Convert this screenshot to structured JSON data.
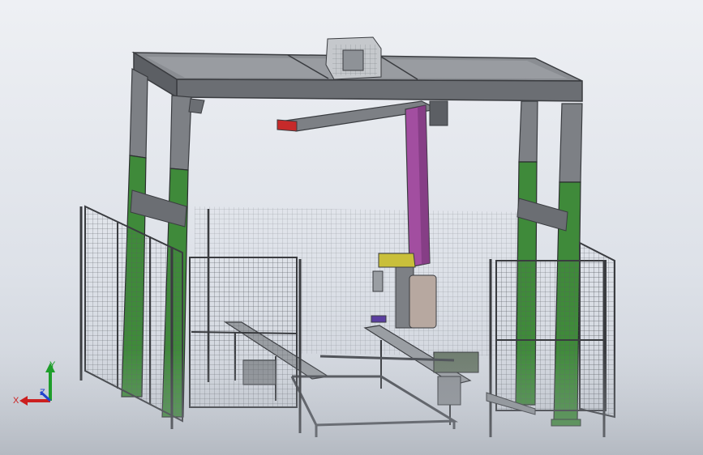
{
  "app": {
    "view": "cad-3d-assembly-viewport"
  },
  "triad": {
    "x_label": "X",
    "y_label": "Y",
    "z_label": "Z",
    "x_color": "#cc1f1f",
    "y_color": "#1e9e2a",
    "z_color": "#2244cc"
  },
  "model": {
    "frame_color": "#6f7278",
    "frame_dark": "#4d5056",
    "green_color": "#3f8a3a",
    "magenta_color": "#a24ea0",
    "yellow_color": "#c9bf3a",
    "red_tip_color": "#c62a2a",
    "mesh_color": "#505458"
  }
}
